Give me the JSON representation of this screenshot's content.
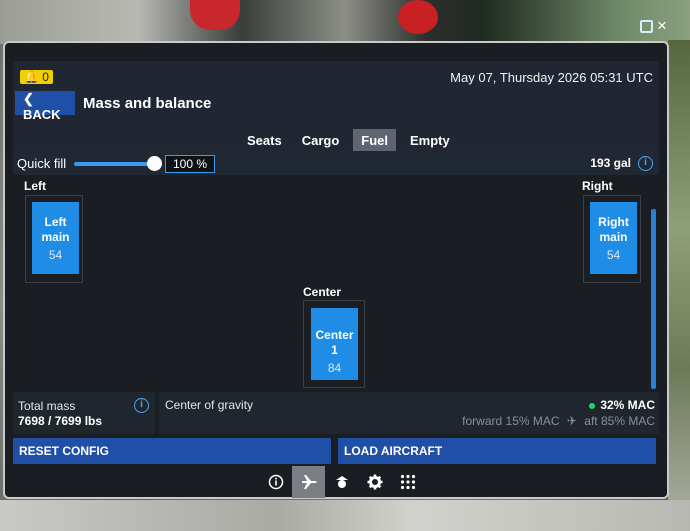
{
  "notification": {
    "count": "0",
    "icon": "bell-icon"
  },
  "datetime": "May 07, Thursday 2026 05:31 UTC",
  "header": {
    "back_label": "BACK",
    "title": "Mass and balance"
  },
  "tabs": [
    {
      "label": "Seats",
      "active": false
    },
    {
      "label": "Cargo",
      "active": false
    },
    {
      "label": "Fuel",
      "active": true
    },
    {
      "label": "Empty",
      "active": false
    }
  ],
  "quick_fill": {
    "label": "Quick fill",
    "value": "100 %",
    "level": 1.0,
    "total": "193 gal"
  },
  "tanks": {
    "left": {
      "group": "Left",
      "name_line1": "Left",
      "name_line2": "main",
      "quantity": "54"
    },
    "right": {
      "group": "Right",
      "name_line1": "Right",
      "name_line2": "main",
      "quantity": "54"
    },
    "center": {
      "group": "Center",
      "name_line1": "Center 1",
      "quantity": "84"
    }
  },
  "total_mass": {
    "label": "Total mass",
    "value": "7698 / 7699 lbs"
  },
  "center_of_gravity": {
    "label": "Center of gravity",
    "value": "32% MAC",
    "forward": "forward 15% MAC",
    "aft": "aft 85% MAC",
    "status_color": "#23d36a"
  },
  "actions": {
    "reset_label": "RESET CONFIG",
    "load_label": "LOAD AIRCRAFT"
  },
  "bottom_nav": [
    "info-icon",
    "airplane-icon",
    "pilot-icon",
    "gear-icon",
    "apps-grid-icon"
  ],
  "colors": {
    "accent": "#1f4fa6",
    "tank": "#1f8de5",
    "notification": "#f2d000"
  }
}
